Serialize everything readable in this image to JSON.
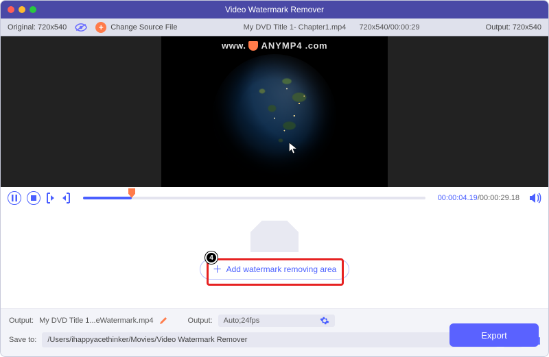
{
  "window": {
    "title": "Video Watermark Remover"
  },
  "topbar": {
    "original_label": "Original: 720x540",
    "change_source_label": "Change Source File",
    "file_name": "My DVD Title 1- Chapter1.mp4",
    "file_meta": "720x540/00:00:29",
    "output_label": "Output: 720x540"
  },
  "watermark": {
    "prefix": "www.",
    "brand": "ANYMP4",
    "suffix": ".com"
  },
  "transport": {
    "current_time": "00:00:04.19",
    "sep": "/",
    "total_time": "00:00:29.18"
  },
  "buttons": {
    "add_area_label": "Add watermark removing area",
    "export_label": "Export"
  },
  "annotations": {
    "step_badge": "4"
  },
  "output_row": {
    "label": "Output:",
    "filename": "My DVD Title 1...eWatermark.mp4",
    "fps_label": "Output:",
    "fps_value": "Auto;24fps"
  },
  "save_row": {
    "label": "Save to:",
    "path": "/Users/ihappyacethinker/Movies/Video Watermark Remover"
  }
}
